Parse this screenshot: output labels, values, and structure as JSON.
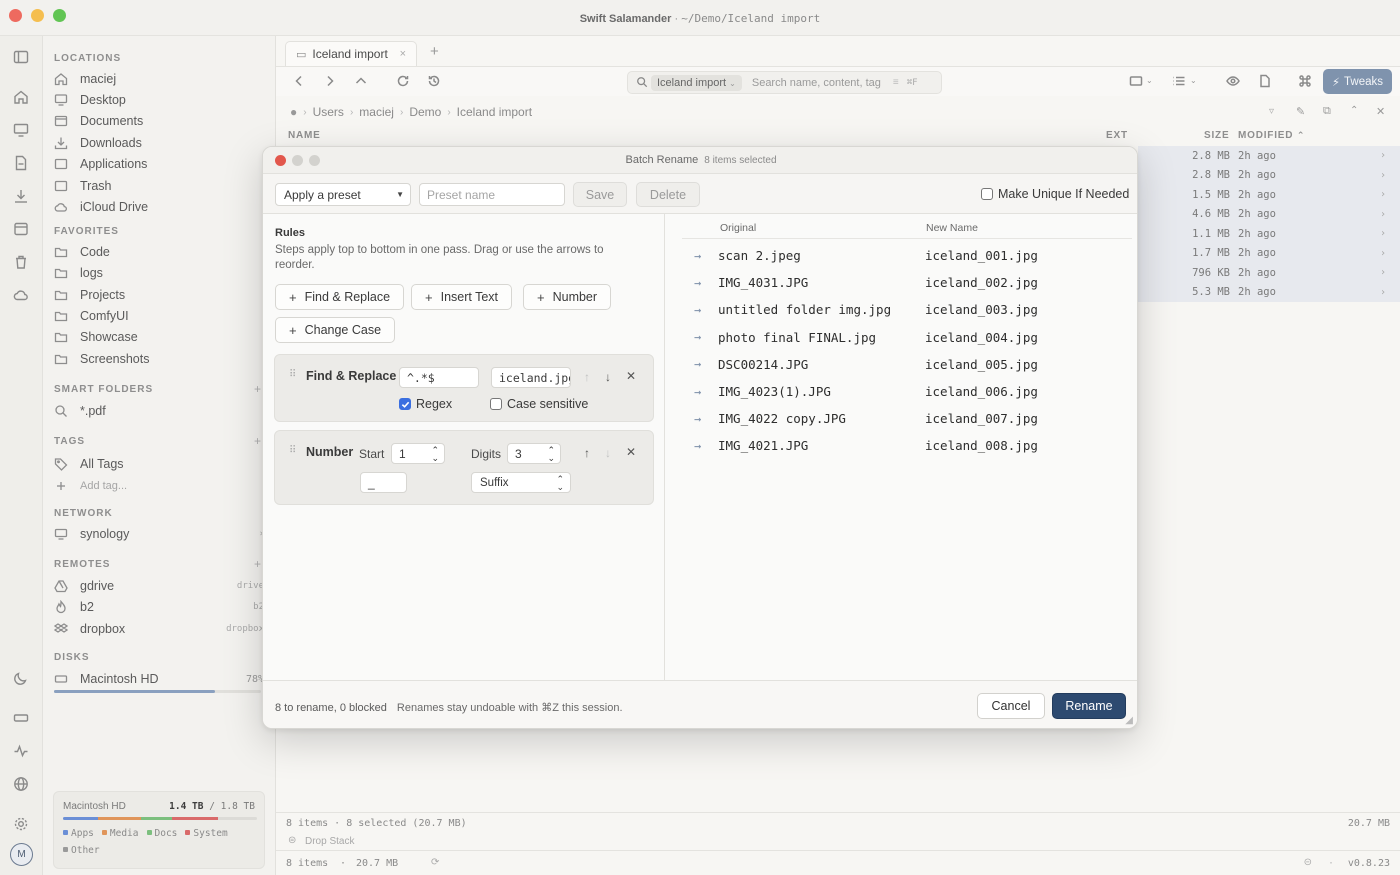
{
  "window": {
    "app_name": "Swift Salamander",
    "separator": "·",
    "path": "~/Demo/Iceland import"
  },
  "colors": {
    "close": "#ee6a5f",
    "minimize": "#f5be4f",
    "zoom": "#62c554",
    "accent": "#2d4a70",
    "tweaks": "#7f93ad"
  },
  "rail_icons": [
    "sidebar-toggle-icon",
    "home-icon",
    "desktop-icon",
    "document-icon",
    "download-icon",
    "applications-icon",
    "trash-icon",
    "cloud-icon",
    "moon-icon",
    "drive-icon",
    "activity-icon",
    "globe-icon",
    "gear-icon"
  ],
  "avatar": "M",
  "sidebar": {
    "locations_header": "LOCATIONS",
    "locations": [
      {
        "label": "maciej",
        "icon": "home-icon"
      },
      {
        "label": "Desktop",
        "icon": "desktop-icon"
      },
      {
        "label": "Documents",
        "icon": "document-icon"
      },
      {
        "label": "Downloads",
        "icon": "download-icon"
      },
      {
        "label": "Applications",
        "icon": "applications-icon"
      },
      {
        "label": "Trash",
        "icon": "trash-icon"
      },
      {
        "label": "iCloud Drive",
        "icon": "cloud-icon"
      }
    ],
    "favorites_header": "FAVORITES",
    "favorites": [
      "Code",
      "logs",
      "Projects",
      "ComfyUI",
      "Showcase",
      "Screenshots"
    ],
    "smart_header": "SMART FOLDERS",
    "smart": [
      "*.pdf"
    ],
    "tags_header": "TAGS",
    "tags_all": "All Tags",
    "tags_add": "Add tag...",
    "network_header": "NETWORK",
    "network": [
      "synology"
    ],
    "remotes_header": "REMOTES",
    "remotes": [
      {
        "label": "gdrive",
        "kind": "drive"
      },
      {
        "label": "b2",
        "kind": "b2"
      },
      {
        "label": "dropbox",
        "kind": "dropbox"
      }
    ],
    "disks_header": "DISKS",
    "disk": {
      "label": "Macintosh HD",
      "percent": "78%",
      "fraction": 0.78
    },
    "disk_card": {
      "title": "Macintosh HD",
      "used": "1.4",
      "used_unit": "TB",
      "total": "/ 1.8 TB",
      "segments": [
        {
          "label": "Apps",
          "color": "#6b8fd6",
          "fraction": 0.18
        },
        {
          "label": "Media",
          "color": "#e0955a",
          "fraction": 0.22
        },
        {
          "label": "Docs",
          "color": "#7cbf7e",
          "fraction": 0.16
        },
        {
          "label": "System",
          "color": "#d96a6a",
          "fraction": 0.24
        },
        {
          "label": "Other",
          "color": "#9a9a9a",
          "fraction": 0.0
        }
      ]
    }
  },
  "tab": {
    "label": "Iceland import",
    "close": "×",
    "new": "+"
  },
  "search": {
    "scope": "Iceland import",
    "placeholder": "Search name, content, tag",
    "shortcut": "⌘F"
  },
  "toolbar": {
    "tweaks": "Tweaks"
  },
  "breadcrumb": [
    "Users",
    "maciej",
    "Demo",
    "Iceland import"
  ],
  "columns": {
    "name": "NAME",
    "ext": "EXT",
    "size": "SIZE",
    "modified": "MODIFIED"
  },
  "file_rows": [
    {
      "size": "2.8 MB",
      "modified": "2h ago"
    },
    {
      "size": "2.8 MB",
      "modified": "2h ago"
    },
    {
      "size": "1.5 MB",
      "modified": "2h ago"
    },
    {
      "size": "4.6 MB",
      "modified": "2h ago"
    },
    {
      "size": "1.1 MB",
      "modified": "2h ago"
    },
    {
      "size": "1.7 MB",
      "modified": "2h ago"
    },
    {
      "size": "796 KB",
      "modified": "2h ago"
    },
    {
      "size": "5.3 MB",
      "modified": "2h ago"
    }
  ],
  "status": {
    "left": "8 items · 8 selected (20.7 MB)",
    "right": "20.7 MB",
    "drop_stack": "Drop Stack",
    "foot_left": "8 items",
    "foot_sep": "·",
    "foot_size": "20.7 MB",
    "version": "v0.8.23"
  },
  "dialog": {
    "title": "Batch Rename",
    "subtitle": "8 items selected",
    "preset_select": "Apply a preset",
    "preset_name_placeholder": "Preset name",
    "save": "Save",
    "delete": "Delete",
    "make_unique": "Make Unique If Needed",
    "rules_title": "Rules",
    "rules_desc": "Steps apply top to bottom in one pass. Drag or use the arrows to reorder.",
    "add_buttons": [
      "Find & Replace",
      "Insert Text",
      "Number",
      "Change Case"
    ],
    "rule_find": {
      "name": "Find & Replace",
      "find": "^.*$",
      "replace": "iceland.jpg",
      "regex": "Regex",
      "case": "Case sensitive"
    },
    "rule_number": {
      "name": "Number",
      "start_label": "Start",
      "start": "1",
      "digits_label": "Digits",
      "digits": "3",
      "separator": "_",
      "position": "Suffix"
    },
    "table_headers": {
      "original": "Original",
      "new": "New Name"
    },
    "mappings": [
      {
        "original": "scan 2.jpeg",
        "new": "iceland_001.jpg"
      },
      {
        "original": "IMG_4031.JPG",
        "new": "iceland_002.jpg"
      },
      {
        "original": "untitled folder img.jpg",
        "new": "iceland_003.jpg"
      },
      {
        "original": "photo final FINAL.jpg",
        "new": "iceland_004.jpg"
      },
      {
        "original": "DSC00214.JPG",
        "new": "iceland_005.jpg"
      },
      {
        "original": "IMG_4023(1).JPG",
        "new": "iceland_006.jpg"
      },
      {
        "original": "IMG_4022 copy.JPG",
        "new": "iceland_007.jpg"
      },
      {
        "original": "IMG_4021.JPG",
        "new": "iceland_008.jpg"
      }
    ],
    "summary": "8 to rename, 0 blocked",
    "note": "Renames stay undoable with ⌘Z this session.",
    "cancel": "Cancel",
    "rename": "Rename"
  }
}
